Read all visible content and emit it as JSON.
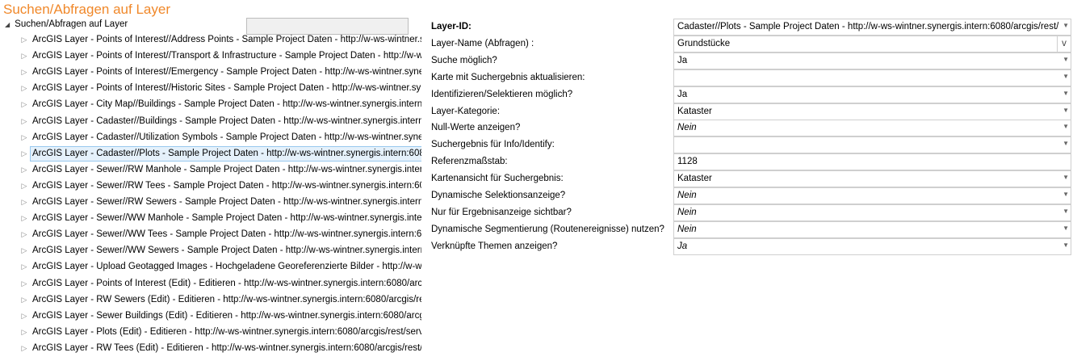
{
  "title": "Suchen/Abfragen auf Layer",
  "tree": {
    "root": "Suchen/Abfragen auf Layer",
    "items": [
      "ArcGIS Layer - Points of Interest//Address Points - Sample Project Daten - http://w-ws-wintner.s",
      "ArcGIS Layer - Points of Interest//Transport & Infrastructure - Sample Project Daten - http://w-w",
      "ArcGIS Layer - Points of Interest//Emergency - Sample Project Daten - http://w-ws-wintner.syner",
      "ArcGIS Layer - Points of Interest//Historic Sites - Sample Project Daten - http://w-ws-wintner.syn",
      "ArcGIS Layer - City Map//Buildings - Sample Project Daten - http://w-ws-wintner.synergis.intern:",
      "ArcGIS Layer - Cadaster//Buildings - Sample Project Daten - http://w-ws-wintner.synergis.intern:",
      "ArcGIS Layer - Cadaster//Utilization Symbols - Sample Project Daten - http://w-ws-wintner.syner",
      "ArcGIS Layer - Cadaster//Plots - Sample Project Daten - http://w-ws-wintner.synergis.intern:608",
      "ArcGIS Layer - Sewer//RW Manhole - Sample Project Daten - http://w-ws-wintner.synergis.inter",
      "ArcGIS Layer - Sewer//RW Tees - Sample Project Daten - http://w-ws-wintner.synergis.intern:608",
      "ArcGIS Layer - Sewer//RW Sewers - Sample Project Daten - http://w-ws-wintner.synergis.intern:6",
      "ArcGIS Layer - Sewer//WW Manhole - Sample Project Daten - http://w-ws-wintner.synergis.inter",
      "ArcGIS Layer - Sewer//WW Tees - Sample Project Daten - http://w-ws-wintner.synergis.intern:60",
      "ArcGIS Layer - Sewer//WW Sewers - Sample Project Daten - http://w-ws-wintner.synergis.intern:",
      "ArcGIS Layer - Upload Geotagged Images - Hochgeladene Georeferenzierte Bilder - http://w-ws",
      "ArcGIS Layer - Points of Interest (Edit) - Editieren - http://w-ws-wintner.synergis.intern:6080/arcg",
      "ArcGIS Layer - RW Sewers (Edit) - Editieren - http://w-ws-wintner.synergis.intern:6080/arcgis/res",
      "ArcGIS Layer - Sewer Buildings (Edit) - Editieren - http://w-ws-wintner.synergis.intern:6080/arcgi",
      "ArcGIS Layer - Plots (Edit) - Editieren - http://w-ws-wintner.synergis.intern:6080/arcgis/rest/servi",
      "ArcGIS Layer - RW Tees (Edit) - Editieren - http://w-ws-wintner.synergis.intern:6080/arcgis/rest/s"
    ],
    "selected_index": 7
  },
  "props": [
    {
      "label": "Layer-ID:",
      "value": "Cadaster//Plots - Sample Project Daten - http://w-ws-wintner.synergis.intern:6080/arcgis/rest/",
      "bold": true,
      "type": "dropdown"
    },
    {
      "label": "Layer-Name (Abfragen) :",
      "value": "Grundstücke",
      "type": "text",
      "button": "v"
    },
    {
      "label": "Suche möglich?",
      "value": "Ja",
      "type": "dropdown"
    },
    {
      "label": "Karte mit Suchergebnis aktualisieren:",
      "value": "",
      "type": "dropdown"
    },
    {
      "label": "Identifizieren/Selektieren möglich?",
      "value": "Ja",
      "type": "dropdown"
    },
    {
      "label": "Layer-Kategorie:",
      "value": "Kataster",
      "type": "dropdown"
    },
    {
      "label": "Null-Werte anzeigen?",
      "value": "Nein",
      "italic": true,
      "type": "dropdown"
    },
    {
      "label": "Suchergebnis für Info/Identify:",
      "value": "",
      "type": "dropdown"
    },
    {
      "label": "Referenzmaßstab:",
      "value": "1128",
      "type": "text"
    },
    {
      "label": "Kartenansicht für Suchergebnis:",
      "value": "Kataster",
      "type": "dropdown"
    },
    {
      "label": "Dynamische Selektionsanzeige?",
      "value": "Nein",
      "italic": true,
      "type": "dropdown"
    },
    {
      "label": "Nur für Ergebnisanzeige sichtbar?",
      "value": "Nein",
      "italic": true,
      "type": "dropdown"
    },
    {
      "label": "Dynamische Segmentierung (Routenereignisse) nutzen?",
      "value": "Nein",
      "italic": true,
      "type": "dropdown"
    },
    {
      "label": "Verknüpfte Themen anzeigen?",
      "value": "Ja",
      "italic": true,
      "type": "dropdown"
    }
  ]
}
